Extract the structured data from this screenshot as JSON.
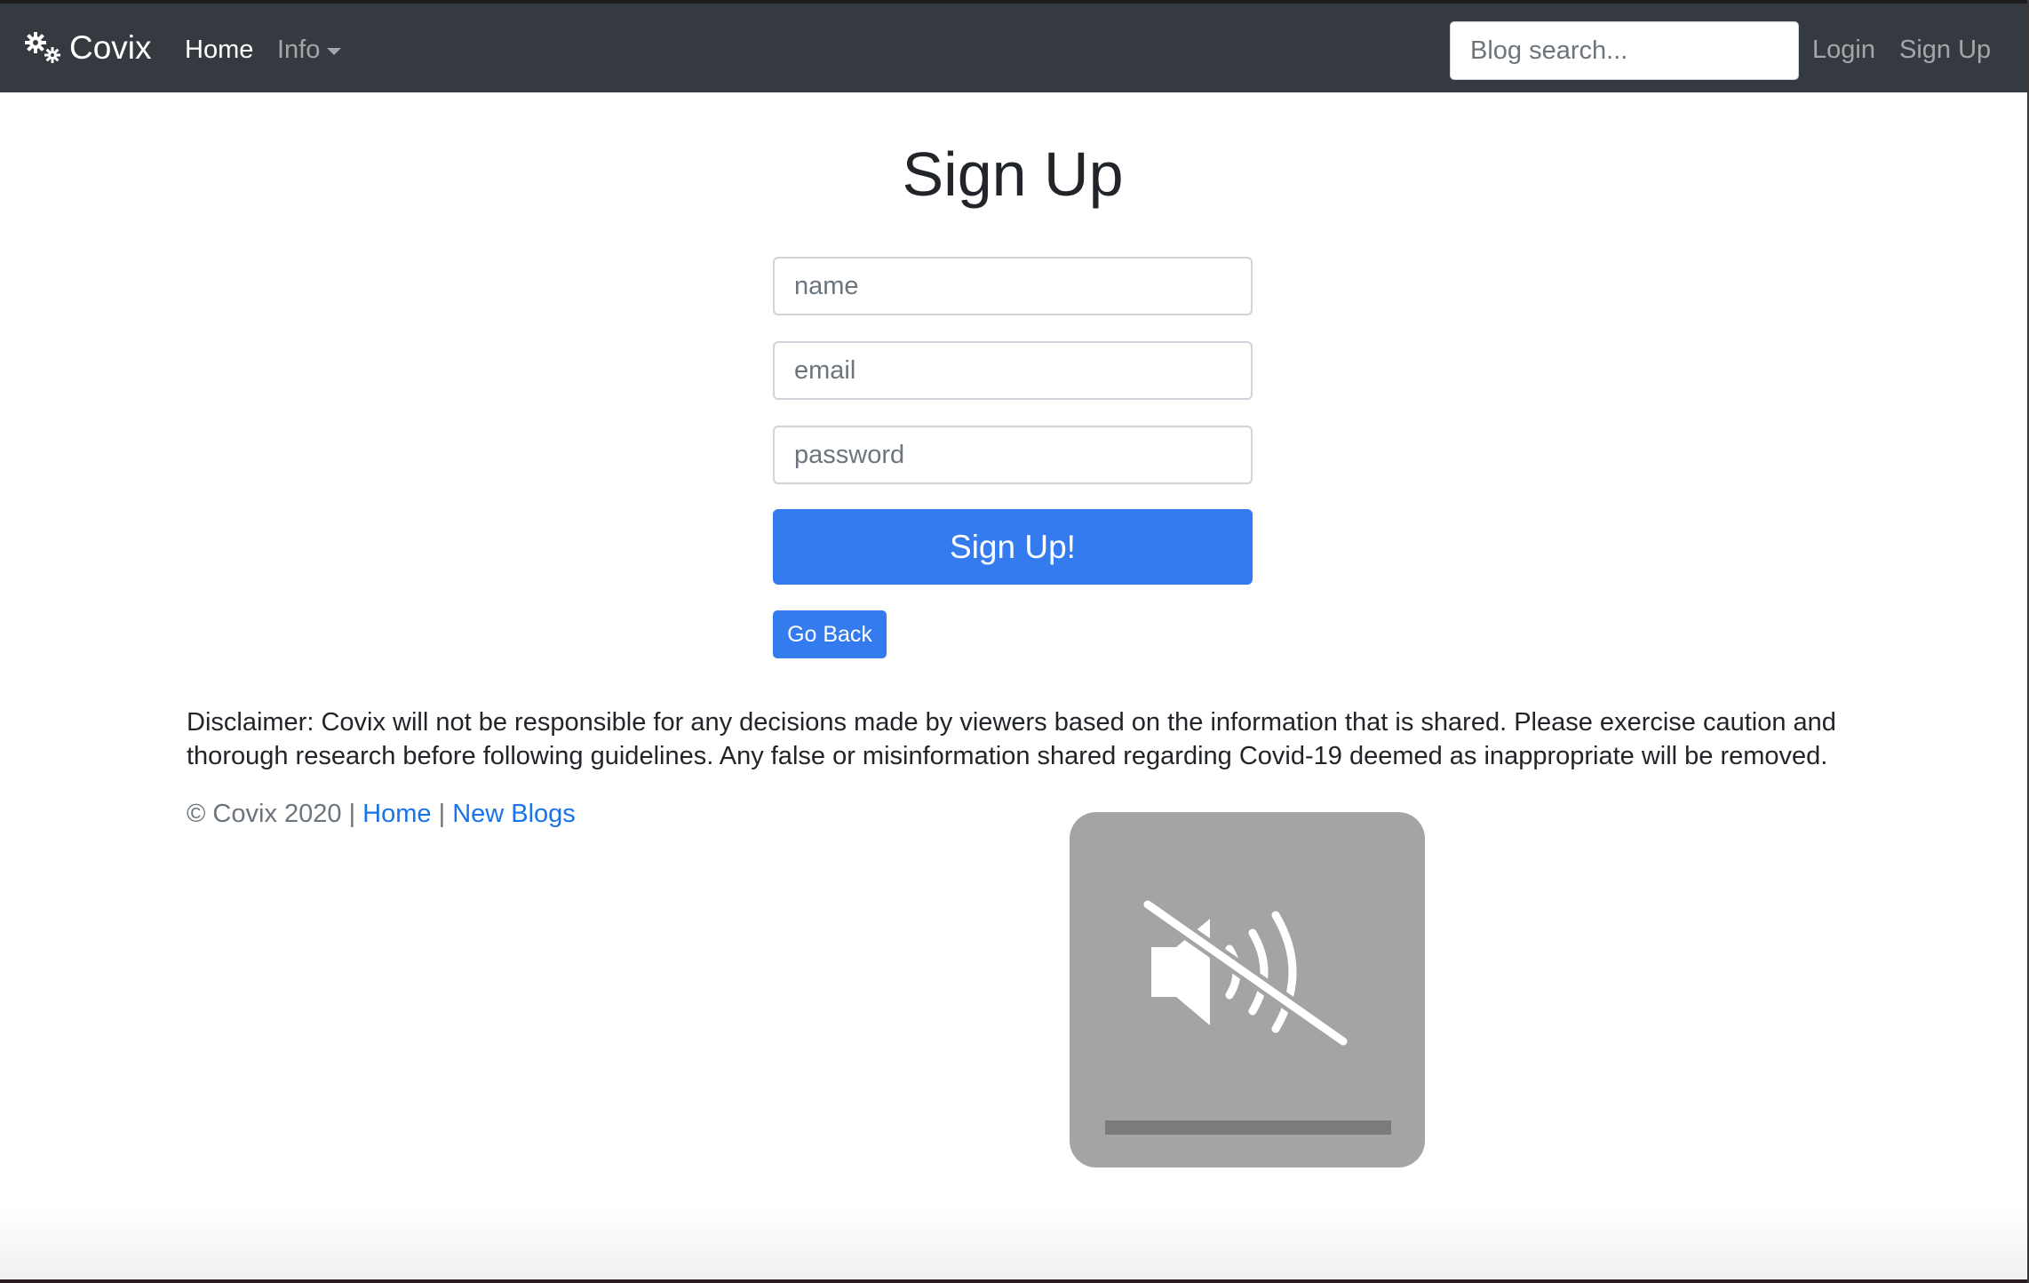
{
  "navbar": {
    "brand": "Covix",
    "brand_icon": "gears-icon",
    "home": "Home",
    "info": "Info",
    "search_placeholder": "Blog search...",
    "login": "Login",
    "signup": "Sign Up"
  },
  "form": {
    "title": "Sign Up",
    "name_placeholder": "name",
    "email_placeholder": "email",
    "password_placeholder": "password",
    "submit_label": "Sign Up!",
    "back_label": "Go Back"
  },
  "footer": {
    "disclaimer": "Disclaimer: Covix will not be responsible for any decisions made by viewers based on the information that is shared. Please exercise caution and thorough research before following guidelines. Any false or misinformation shared regarding Covid-19 deemed as inappropriate will be removed.",
    "copyright": "© Covix 2020 |",
    "separator": "|",
    "home_link": "Home",
    "new_blogs_link": "New Blogs"
  },
  "overlay": {
    "icon": "speaker-muted-icon",
    "volume_level": 0
  },
  "colors": {
    "navbar_bg": "#343a40",
    "primary": "#357bf0",
    "link": "#1a73e8"
  }
}
